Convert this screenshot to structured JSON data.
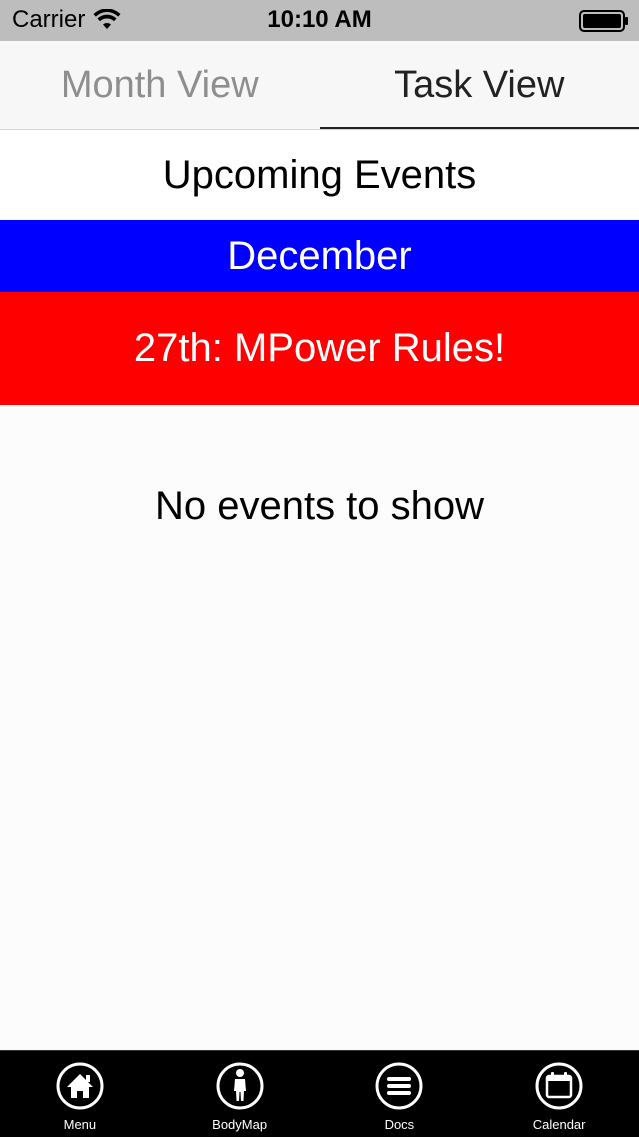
{
  "status_bar": {
    "carrier": "Carrier",
    "time": "10:10 AM"
  },
  "segments": {
    "month_view": "Month View",
    "task_view": "Task View",
    "selected": "Task View"
  },
  "page_title": "Upcoming Events",
  "month_banner": {
    "label": "December",
    "color": "#0000ff"
  },
  "events": [
    {
      "label": "27th: MPower Rules!",
      "color": "#ff0000"
    }
  ],
  "empty_message": "No events to show",
  "tab_bar": {
    "items": [
      {
        "label": "Menu",
        "icon": "home-icon"
      },
      {
        "label": "BodyMap",
        "icon": "person-icon"
      },
      {
        "label": "Docs",
        "icon": "list-icon"
      },
      {
        "label": "Calendar",
        "icon": "calendar-icon"
      }
    ]
  }
}
